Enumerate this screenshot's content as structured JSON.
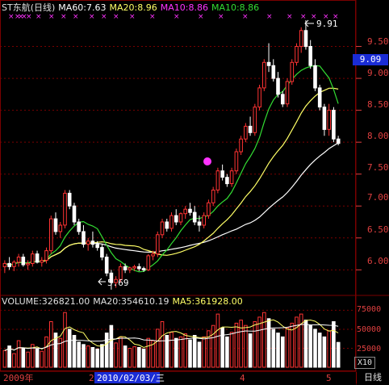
{
  "header": {
    "stock_name": "ST东航(日线)",
    "ma60": "MA60:7.63",
    "ma20": "MA20:8.96",
    "ma10_a": "MA10:8.86",
    "ma10_b": "MA10:8.86"
  },
  "current_price": "9.09",
  "price_axis": [
    "9.50",
    "9.00",
    "8.50",
    "8.00",
    "7.50",
    "7.00",
    "6.50",
    "6.00"
  ],
  "annotations": {
    "high": "9.91",
    "low": "5.69"
  },
  "volume_header": {
    "volume": "VOLUME:326821.00",
    "ma20": "MA20:354610.19",
    "ma5": "MA5:361928.00"
  },
  "volume_axis": [
    "75000",
    "50000",
    "25000"
  ],
  "volume_scale": "X10",
  "date_axis": {
    "year": "2009年",
    "month_2": "2",
    "selected_date": "2010/02/03/三",
    "month_4": "4",
    "month_5": "5"
  },
  "period_label": "日线",
  "colors": {
    "background": "#000000",
    "up": "#ff3333",
    "down": "#ffffff",
    "ma_white": "#ffffff",
    "ma_yellow": "#ffff66",
    "ma_magenta": "#ff33ff",
    "ma_green": "#33dd33",
    "grid": "#7a0000",
    "date_highlight": "#1a2cd6"
  },
  "chart_data": {
    "type": "candlestick",
    "title": "ST东航(日线)",
    "price_ylim": [
      5.65,
      10.0
    ],
    "candles": [
      [
        6.05,
        6.15,
        5.95,
        6.1
      ],
      [
        6.1,
        6.2,
        6.0,
        6.05
      ],
      [
        6.05,
        6.15,
        5.98,
        6.12
      ],
      [
        6.12,
        6.25,
        6.05,
        6.2
      ],
      [
        6.2,
        6.25,
        6.05,
        6.08
      ],
      [
        6.08,
        6.15,
        6.0,
        6.1
      ],
      [
        6.1,
        6.3,
        6.05,
        6.25
      ],
      [
        6.25,
        6.3,
        6.1,
        6.12
      ],
      [
        6.12,
        6.2,
        6.05,
        6.15
      ],
      [
        6.15,
        6.35,
        6.1,
        6.3
      ],
      [
        6.3,
        6.85,
        6.25,
        6.8
      ],
      [
        6.8,
        6.9,
        6.55,
        6.6
      ],
      [
        6.6,
        6.75,
        6.5,
        6.7
      ],
      [
        6.7,
        7.25,
        6.65,
        7.2
      ],
      [
        7.2,
        7.25,
        6.95,
        7.0
      ],
      [
        7.0,
        7.05,
        6.7,
        6.75
      ],
      [
        6.75,
        6.8,
        6.55,
        6.6
      ],
      [
        6.6,
        6.7,
        6.35,
        6.4
      ],
      [
        6.4,
        6.5,
        6.3,
        6.45
      ],
      [
        6.45,
        6.6,
        6.35,
        6.4
      ],
      [
        6.4,
        6.45,
        6.3,
        6.35
      ],
      [
        6.35,
        6.4,
        6.15,
        6.2
      ],
      [
        6.2,
        6.25,
        5.9,
        5.95
      ],
      [
        5.95,
        6.0,
        5.69,
        5.8
      ],
      [
        5.8,
        5.9,
        5.72,
        5.85
      ],
      [
        5.85,
        6.1,
        5.8,
        6.05
      ],
      [
        6.05,
        6.1,
        5.95,
        6.0
      ],
      [
        6.0,
        6.05,
        5.95,
        6.03
      ],
      [
        6.03,
        6.08,
        5.98,
        6.05
      ],
      [
        6.05,
        6.1,
        5.98,
        6.02
      ],
      [
        6.02,
        6.05,
        5.97,
        6.0
      ],
      [
        6.0,
        6.25,
        5.98,
        6.22
      ],
      [
        6.22,
        6.3,
        6.15,
        6.25
      ],
      [
        6.25,
        6.6,
        6.2,
        6.55
      ],
      [
        6.55,
        6.8,
        6.5,
        6.75
      ],
      [
        6.75,
        6.8,
        6.6,
        6.65
      ],
      [
        6.65,
        6.9,
        6.6,
        6.85
      ],
      [
        6.85,
        6.95,
        6.7,
        6.75
      ],
      [
        6.75,
        6.9,
        6.7,
        6.88
      ],
      [
        6.88,
        7.0,
        6.8,
        6.95
      ],
      [
        6.95,
        7.05,
        6.85,
        6.9
      ],
      [
        6.9,
        7.0,
        6.7,
        6.75
      ],
      [
        6.75,
        6.85,
        6.6,
        6.7
      ],
      [
        6.7,
        6.9,
        6.65,
        6.85
      ],
      [
        6.85,
        7.1,
        6.8,
        7.05
      ],
      [
        7.05,
        7.3,
        7.0,
        7.25
      ],
      [
        7.25,
        7.6,
        7.2,
        7.55
      ],
      [
        7.55,
        7.65,
        7.4,
        7.45
      ],
      [
        7.45,
        7.5,
        7.3,
        7.35
      ],
      [
        7.35,
        7.6,
        7.3,
        7.55
      ],
      [
        7.55,
        7.9,
        7.5,
        7.85
      ],
      [
        7.85,
        8.1,
        7.8,
        8.05
      ],
      [
        8.05,
        8.3,
        8.0,
        8.25
      ],
      [
        8.25,
        8.4,
        8.1,
        8.15
      ],
      [
        8.15,
        8.6,
        8.1,
        8.55
      ],
      [
        8.55,
        8.9,
        8.5,
        8.85
      ],
      [
        8.85,
        9.3,
        8.8,
        9.25
      ],
      [
        9.25,
        9.55,
        9.1,
        9.2
      ],
      [
        9.2,
        9.3,
        8.95,
        9.0
      ],
      [
        9.0,
        9.1,
        8.7,
        8.75
      ],
      [
        8.75,
        8.8,
        8.55,
        8.6
      ],
      [
        8.6,
        9.0,
        8.55,
        8.95
      ],
      [
        8.95,
        9.3,
        8.9,
        9.25
      ],
      [
        9.25,
        9.55,
        9.2,
        9.5
      ],
      [
        9.5,
        9.8,
        9.4,
        9.75
      ],
      [
        9.75,
        9.91,
        9.45,
        9.5
      ],
      [
        9.5,
        9.6,
        9.15,
        9.2
      ],
      [
        9.2,
        9.3,
        8.8,
        8.85
      ],
      [
        8.85,
        8.9,
        8.5,
        8.55
      ],
      [
        8.55,
        8.6,
        8.1,
        8.2
      ],
      [
        8.2,
        8.6,
        8.1,
        8.5
      ],
      [
        8.5,
        8.55,
        8.0,
        8.05
      ],
      [
        8.05,
        8.1,
        7.95,
        7.98
      ]
    ],
    "volume_ylim": [
      0,
      85000
    ],
    "volumes_x10": [
      22000,
      28000,
      18000,
      35000,
      25000,
      20000,
      30000,
      24000,
      21000,
      40000,
      60000,
      45000,
      38000,
      72000,
      50000,
      42000,
      33000,
      30000,
      28000,
      26000,
      24000,
      30000,
      45000,
      55000,
      32000,
      40000,
      28000,
      25000,
      27000,
      26000,
      24000,
      38000,
      35000,
      50000,
      60000,
      42000,
      46000,
      38000,
      40000,
      44000,
      36000,
      42000,
      33000,
      40000,
      48000,
      55000,
      70000,
      52000,
      40000,
      46000,
      58000,
      62000,
      55000,
      44000,
      60000,
      66000,
      72000,
      64000,
      50000,
      45000,
      40000,
      52000,
      58000,
      66000,
      70000,
      62000,
      55000,
      50000,
      45000,
      40000,
      48000,
      60000,
      32682
    ]
  }
}
